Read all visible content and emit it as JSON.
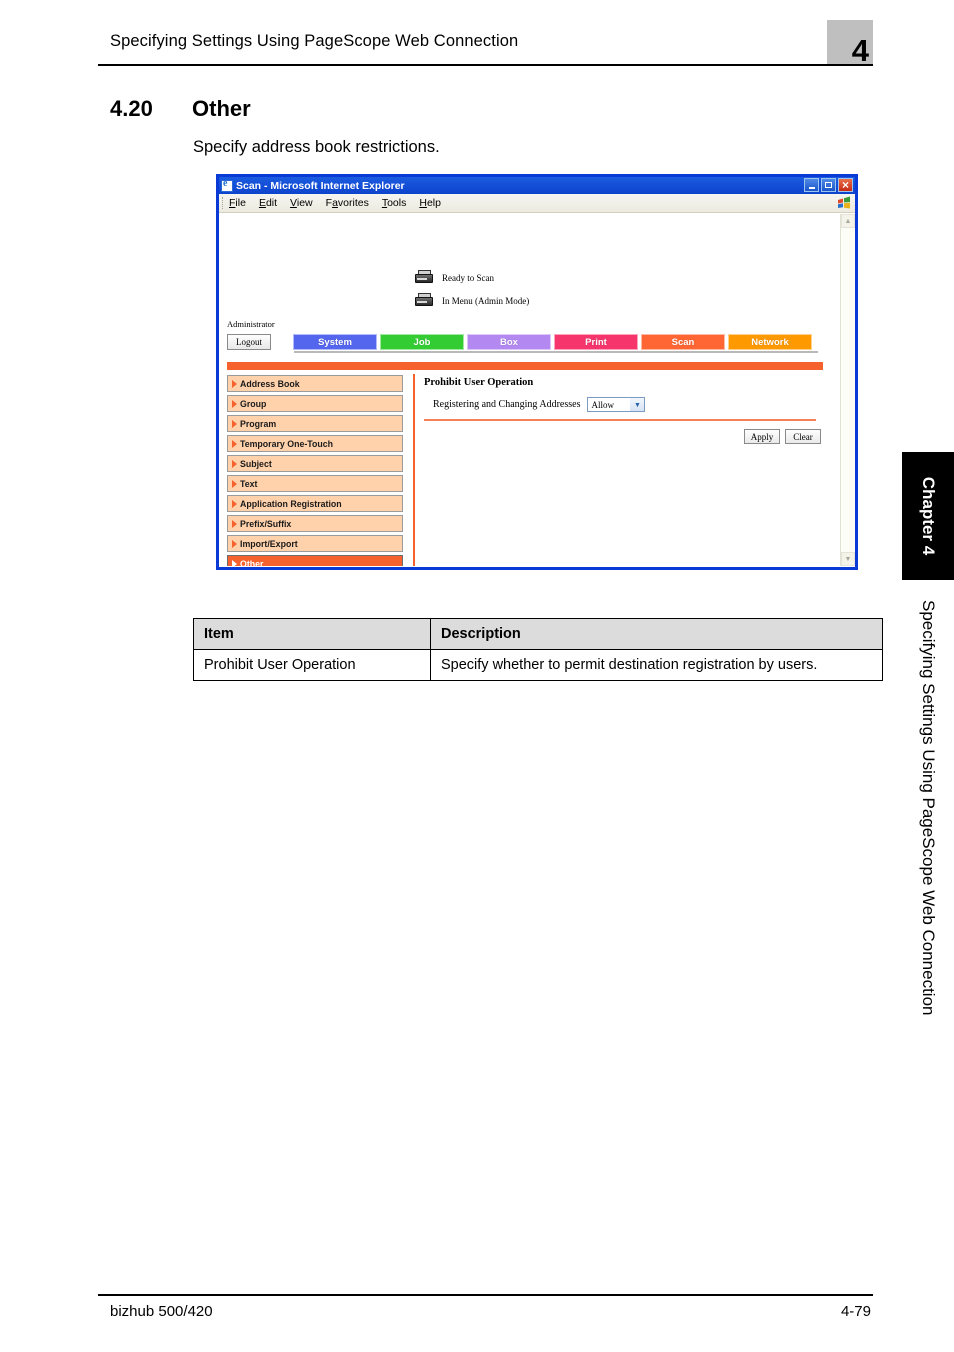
{
  "page": {
    "running_head": "Specifying Settings Using PageScope Web Connection",
    "chapter_number": "4",
    "section_number": "4.20",
    "section_title": "Other",
    "section_description": "Specify address book restrictions.",
    "footer_left": "bizhub 500/420",
    "footer_right": "4-79",
    "side_chapter_tab": "Chapter 4",
    "side_running_head": "Specifying Settings Using PageScope Web Connection"
  },
  "browser": {
    "title": "Scan - Microsoft Internet Explorer",
    "title_icon": "ie-document-icon",
    "window_buttons": [
      {
        "name": "minimize-button",
        "glyph": "minimize-icon"
      },
      {
        "name": "maximize-button",
        "glyph": "maximize-icon"
      },
      {
        "name": "close-button",
        "glyph": "close-icon"
      }
    ],
    "menu": [
      {
        "label": "File",
        "accel": "F"
      },
      {
        "label": "Edit",
        "accel": "E"
      },
      {
        "label": "View",
        "accel": "V"
      },
      {
        "label": "Favorites",
        "accel": "a"
      },
      {
        "label": "Tools",
        "accel": "T"
      },
      {
        "label": "Help",
        "accel": "H"
      }
    ],
    "scrollbar": {
      "up_glyph": "▲",
      "down_glyph": "▼"
    }
  },
  "webpage": {
    "status": [
      {
        "icon": "scanner-icon",
        "text": "Ready to Scan"
      },
      {
        "icon": "printer-icon",
        "text": "In Menu (Admin Mode)"
      }
    ],
    "user_label": "Administrator",
    "logout_label": "Logout",
    "nav_tabs": [
      {
        "label": "System",
        "color": "#5566ee"
      },
      {
        "label": "Job",
        "color": "#33cc33"
      },
      {
        "label": "Box",
        "color": "#b388f0"
      },
      {
        "label": "Print",
        "color": "#f5356b"
      },
      {
        "label": "Scan",
        "color": "#ff6633"
      },
      {
        "label": "Network",
        "color": "#ff9900"
      }
    ],
    "sidebar": [
      {
        "label": "Address Book",
        "selected": false
      },
      {
        "label": "Group",
        "selected": false
      },
      {
        "label": "Program",
        "selected": false
      },
      {
        "label": "Temporary One-Touch",
        "selected": false
      },
      {
        "label": "Subject",
        "selected": false
      },
      {
        "label": "Text",
        "selected": false
      },
      {
        "label": "Application Registration",
        "selected": false
      },
      {
        "label": "Prefix/Suffix",
        "selected": false
      },
      {
        "label": "Import/Export",
        "selected": false
      },
      {
        "label": "Other",
        "selected": true
      }
    ],
    "panel": {
      "title": "Prohibit User Operation",
      "field_label": "Registering and Changing Addresses",
      "field_value": "Allow",
      "field_options": [
        "Allow"
      ],
      "apply_label": "Apply",
      "clear_label": "Clear"
    },
    "accent_color": "#f5622d"
  },
  "info_table": {
    "headers": [
      "Item",
      "Description"
    ],
    "rows": [
      [
        "Prohibit User Operation",
        "Specify whether to permit destination registration by users."
      ]
    ]
  }
}
